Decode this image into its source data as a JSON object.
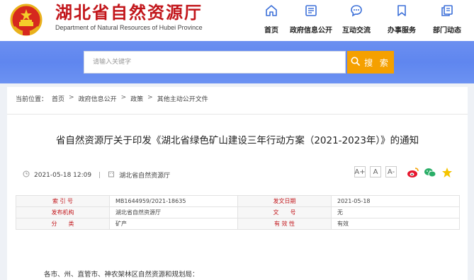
{
  "site": {
    "title": "湖北省自然资源厅",
    "subtitle": "Department of Natural Resources of Hubei Province"
  },
  "nav": [
    {
      "label": "首页",
      "icon": "home-icon"
    },
    {
      "label": "政府信息公开",
      "icon": "document-list-icon"
    },
    {
      "label": "互动交流",
      "icon": "chat-bubble-icon"
    },
    {
      "label": "办事服务",
      "icon": "bookmark-icon"
    },
    {
      "label": "部门动态",
      "icon": "copy-document-icon"
    }
  ],
  "search": {
    "placeholder": "请输入关键字",
    "button_label": "搜 索"
  },
  "breadcrumb": {
    "prefix": "当前位置：",
    "items": [
      "首页",
      "政府信息公开",
      "政策",
      "其他主动公开文件"
    ]
  },
  "article": {
    "title": "省自然资源厅关于印发《湖北省绿色矿山建设三年行动方案（2021-2023年）》的通知",
    "datetime": "2021-05-18 12:09",
    "publisher": "湖北省自然资源厅",
    "body_first_line": "各市、州、直管市、神农架林区自然资源和规划局："
  },
  "font_sizes": [
    "A+",
    "A",
    "A-"
  ],
  "share": [
    "weibo-icon",
    "wechat-icon",
    "favorite-star-icon"
  ],
  "info_table": [
    [
      "索 引 号",
      "MB1644959/2021-18635",
      "发文日期",
      "2021-05-18"
    ],
    [
      "发布机构",
      "湖北省自然资源厅",
      "文　　号",
      "无"
    ],
    [
      "分　　类",
      "矿产",
      "有 效 性",
      "有效"
    ]
  ],
  "colors": {
    "brand_red": "#c2161b",
    "search_band": "#6b8ff0",
    "search_button": "#f5a000",
    "background": "#eef1f6"
  }
}
